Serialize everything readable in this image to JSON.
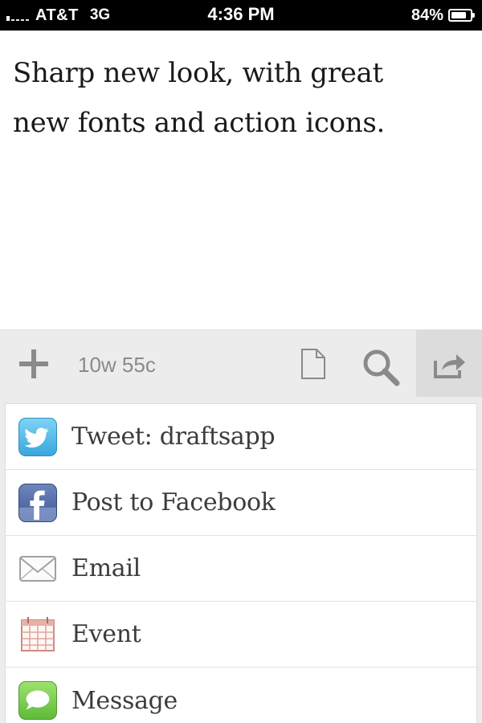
{
  "status_bar": {
    "carrier": "AT&T",
    "network": "3G",
    "time": "4:36 PM",
    "battery": "84%",
    "battery_level": 0.84
  },
  "editor": {
    "text_line1": "Sharp new look, with great",
    "text_line2": "new fonts and action icons."
  },
  "toolbar": {
    "counter": "10w 55c",
    "icons": [
      "plus-icon",
      "document-icon",
      "search-icon",
      "share-icon"
    ]
  },
  "actions": [
    {
      "label": "Tweet: draftsapp",
      "icon": "twitter-icon",
      "color": "#39a7dc"
    },
    {
      "label": "Post to Facebook",
      "icon": "facebook-icon",
      "color": "#3d5897"
    },
    {
      "label": "Email",
      "icon": "envelope-icon",
      "color": "#a0a0a0"
    },
    {
      "label": "Event",
      "icon": "calendar-icon",
      "color": "#d08a80"
    },
    {
      "label": "Message",
      "icon": "message-bubble-icon",
      "color": "#5fba3a"
    }
  ],
  "colors": {
    "toolbar_bg": "#ececec",
    "icon_gray": "#8a8a8a",
    "text_dark": "#1a1a1a",
    "label_text": "#3c3c3c"
  }
}
